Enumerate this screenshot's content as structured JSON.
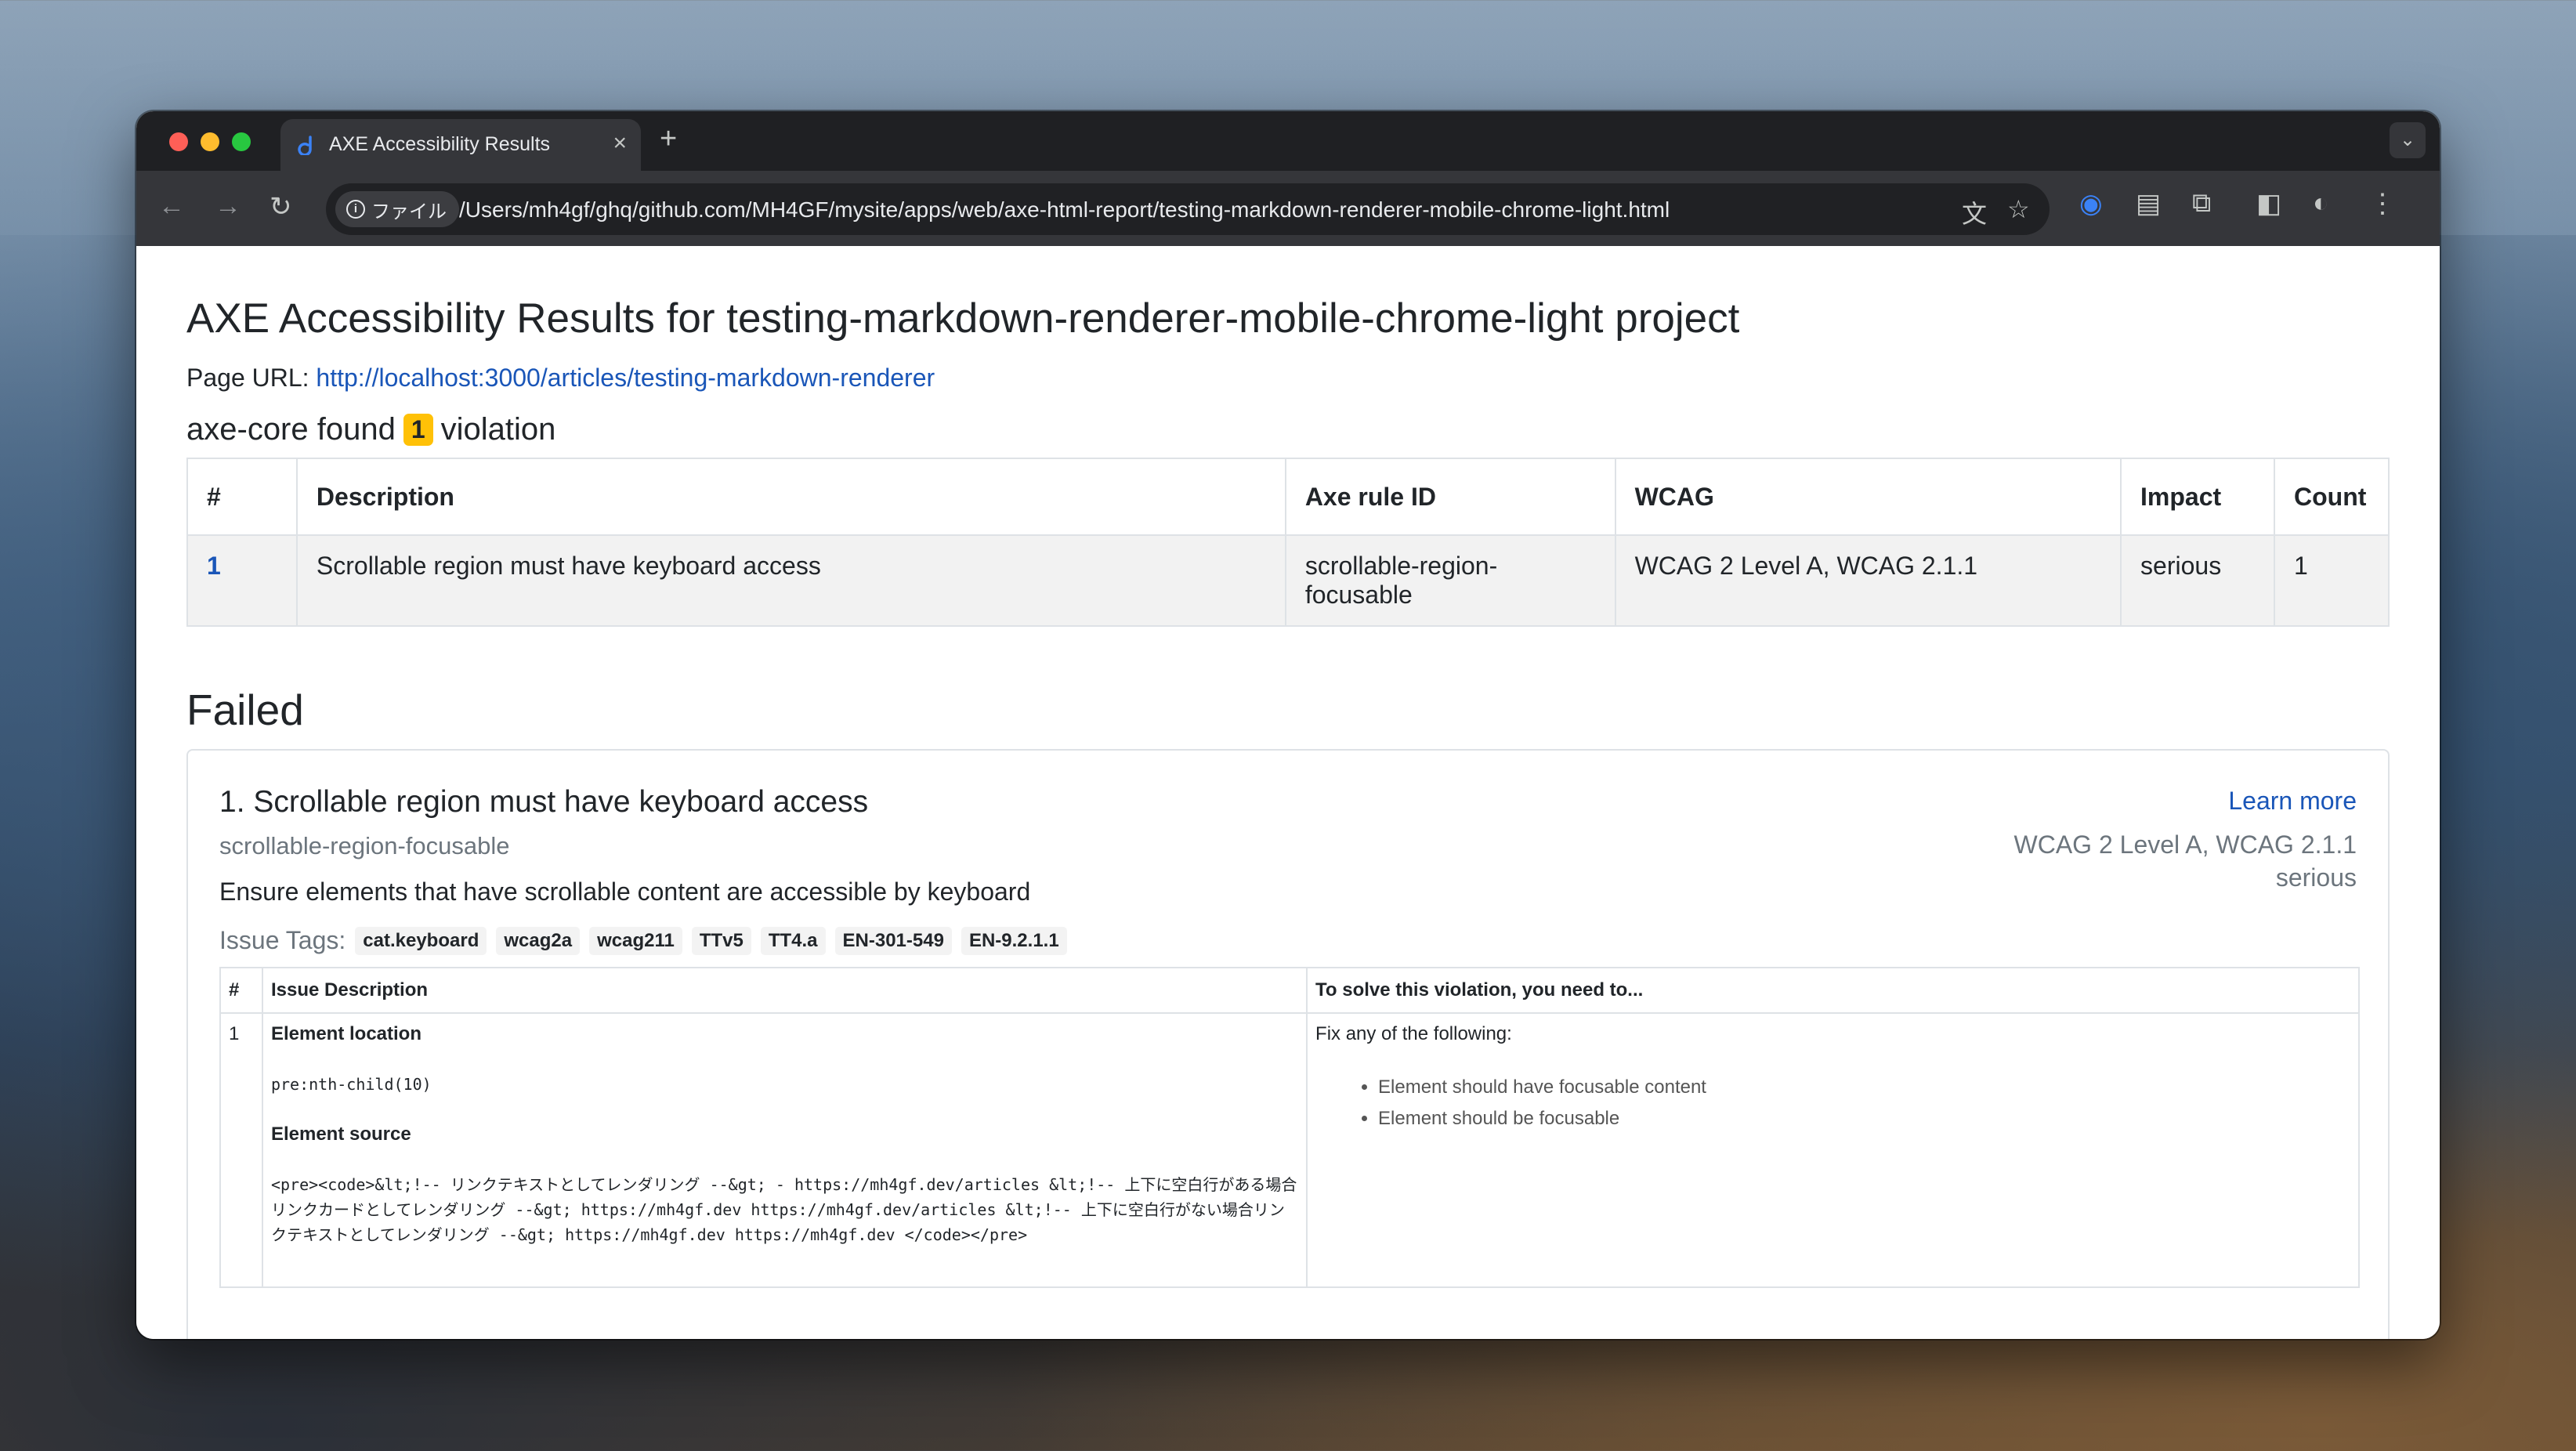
{
  "browser": {
    "tab_title": "AXE Accessibility Results",
    "chip_label": "ファイル",
    "url": "/Users/mh4gf/ghq/github.com/MH4GF/mysite/apps/web/axe-html-report/testing-markdown-renderer-mobile-chrome-light.html"
  },
  "page": {
    "title": "AXE Accessibility Results for testing-markdown-renderer-mobile-chrome-light project",
    "url_label": "Page URL:",
    "url_link": "http://localhost:3000/articles/testing-markdown-renderer",
    "found_prefix": "axe-core found",
    "found_count": "1",
    "found_suffix": "violation"
  },
  "summary_table": {
    "headers": [
      "#",
      "Description",
      "Axe rule ID",
      "WCAG",
      "Impact",
      "Count"
    ],
    "rows": [
      {
        "idx": "1",
        "description": "Scrollable region must have keyboard access",
        "rule": "scrollable-region-focusable",
        "wcag": "WCAG 2 Level A, WCAG 2.1.1",
        "impact": "serious",
        "count": "1"
      }
    ]
  },
  "failed": {
    "heading": "Failed",
    "title": "1. Scrollable region must have keyboard access",
    "rule_id": "scrollable-region-focusable",
    "description": "Ensure elements that have scrollable content are accessible by keyboard",
    "learn_more": "Learn more",
    "wcag": "WCAG 2 Level A, WCAG 2.1.1",
    "impact": "serious",
    "tags_label": "Issue Tags:",
    "tags": [
      "cat.keyboard",
      "wcag2a",
      "wcag211",
      "TTv5",
      "TT4.a",
      "EN-301-549",
      "EN-9.2.1.1"
    ],
    "detail_headers": [
      "#",
      "Issue Description",
      "To solve this violation, you need to..."
    ],
    "detail_row": {
      "idx": "1",
      "location_label": "Element location",
      "location": "pre:nth-child(10)",
      "source_label": "Element source",
      "source": "<pre><code>&lt;!-- リンクテキストとしてレンダリング --&gt; - https://mh4gf.dev/articles &lt;!-- 上下に空白行がある場合リンクカードとしてレンダリング --&gt; https://mh4gf.dev https://mh4gf.dev/articles &lt;!-- 上下に空白行がない場合リンクテキストとしてレンダリング --&gt; https://mh4gf.dev https://mh4gf.dev </code></pre>",
      "fix_intro": "Fix any of the following:",
      "fixes": [
        "Element should have focusable content",
        "Element should be focusable"
      ]
    }
  }
}
